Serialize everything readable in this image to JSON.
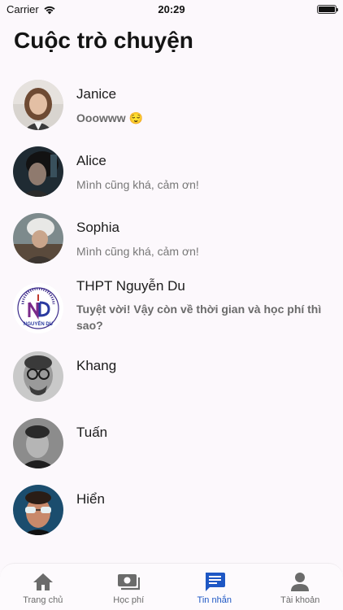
{
  "status": {
    "carrier": "Carrier",
    "time": "20:29"
  },
  "title": "Cuộc trò chuyện",
  "conversations": [
    {
      "name": "Janice",
      "message": "Ooowww 😌",
      "unread": true
    },
    {
      "name": "Alice",
      "message": "Mình cũng khá, cảm ơn!",
      "unread": false
    },
    {
      "name": "Sophia",
      "message": "Mình cũng khá, cảm ơn!",
      "unread": false
    },
    {
      "name": "THPT Nguyễn Du",
      "message": "Tuyệt vời! Vậy còn về thời gian và học phí thì sao?",
      "unread": true
    },
    {
      "name": "Khang",
      "message": "",
      "unread": false
    },
    {
      "name": "Tuấn",
      "message": "",
      "unread": false
    },
    {
      "name": "Hiển",
      "message": "",
      "unread": false
    }
  ],
  "logo_text": "NGUYỄN DU",
  "tabs": [
    {
      "label": "Trang chủ",
      "icon": "home-icon",
      "active": false
    },
    {
      "label": "Học phí",
      "icon": "money-icon",
      "active": false
    },
    {
      "label": "Tin nhắn",
      "icon": "chat-icon",
      "active": true
    },
    {
      "label": "Tài khoản",
      "icon": "account-icon",
      "active": false
    }
  ],
  "colors": {
    "accent": "#1e57c4",
    "inactive": "#6b6b6b",
    "background": "#fcf8fc"
  }
}
